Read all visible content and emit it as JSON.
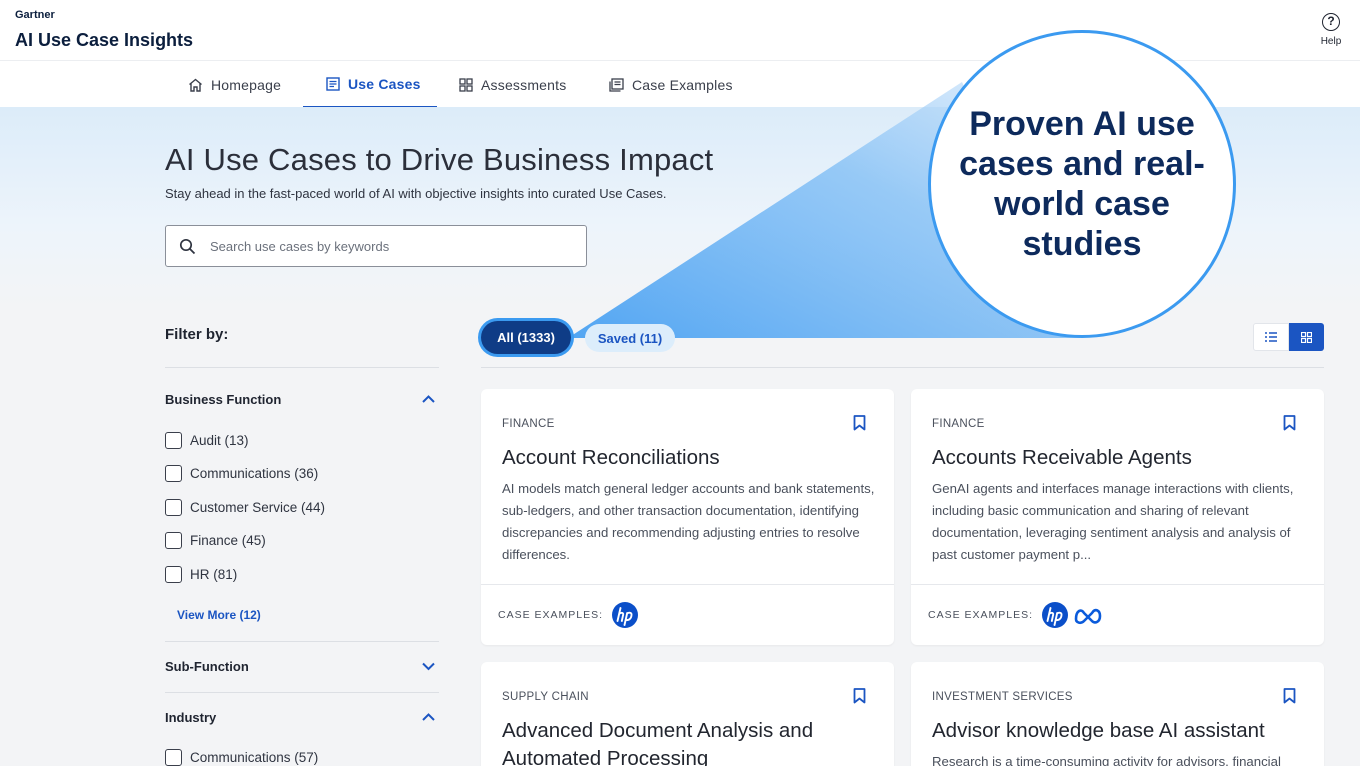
{
  "header": {
    "brand": "Gartner",
    "title": "AI Use Case Insights",
    "help_icon_glyph": "?",
    "help_label": "Help"
  },
  "nav": {
    "tabs": [
      {
        "label": "Homepage",
        "icon": "home-icon",
        "active": false
      },
      {
        "label": "Use Cases",
        "icon": "list-doc-icon",
        "active": true
      },
      {
        "label": "Assessments",
        "icon": "grid-icon",
        "active": false
      },
      {
        "label": "Case Examples",
        "icon": "stack-doc-icon",
        "active": false
      }
    ]
  },
  "hero": {
    "title": "AI Use Cases to Drive Business Impact",
    "subtitle": "Stay ahead in the fast-paced world of AI with objective insights into curated Use Cases.",
    "search_placeholder": "Search use cases by keywords",
    "search_value": ""
  },
  "callout": {
    "text": "Proven AI use cases and real-world case studies"
  },
  "filters": {
    "title": "Filter by:",
    "business_function": {
      "title": "Business Function",
      "expanded": true,
      "options": [
        "Audit (13)",
        "Communications (36)",
        "Customer Service (44)",
        "Finance (45)",
        "HR (81)"
      ],
      "view_more": "View More (12)"
    },
    "sub_function": {
      "title": "Sub-Function",
      "expanded": false
    },
    "industry": {
      "title": "Industry",
      "expanded": true,
      "options": [
        "Communications (57)"
      ]
    }
  },
  "pills": {
    "all": "All (1333)",
    "saved": "Saved (11)"
  },
  "view_toggle": {
    "list_icon": "list-view-icon",
    "grid_icon": "grid-view-icon",
    "selected": "grid"
  },
  "cards": [
    {
      "category": "FINANCE",
      "title": "Account Reconciliations",
      "description": "AI models match general ledger accounts and bank statements, sub-ledgers, and other transaction documentation, identifying discrepancies and recommending adjusting entries to resolve differences.",
      "case_examples_label": "CASE EXAMPLES:",
      "logos": [
        "hp"
      ]
    },
    {
      "category": "FINANCE",
      "title": "Accounts Receivable Agents",
      "description": "GenAI agents and interfaces manage interactions with clients, including basic communication and sharing of relevant documentation, leveraging sentiment analysis and analysis of past customer payment p...",
      "case_examples_label": "CASE EXAMPLES:",
      "logos": [
        "hp",
        "meta"
      ]
    },
    {
      "category": "SUPPLY CHAIN",
      "title": "Advanced Document Analysis and Automated Processing",
      "description": ""
    },
    {
      "category": "INVESTMENT SERVICES",
      "title": "Advisor knowledge base AI assistant",
      "description": "Research is a time-consuming activity for advisors, financial"
    }
  ],
  "colors": {
    "accent": "#1b55c2",
    "navy": "#0f3c86",
    "callout_border": "#3b9af0",
    "callout_text": "#0d2a5c"
  }
}
